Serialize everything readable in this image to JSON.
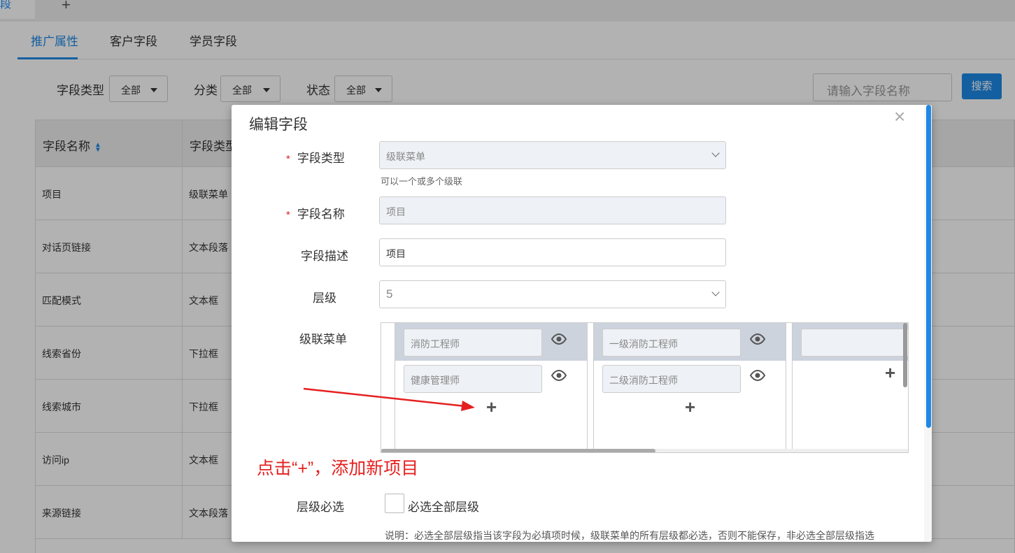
{
  "top_tabs": {
    "active_label": "段",
    "add_label": "+"
  },
  "subtabs": [
    "推广属性",
    "客户字段",
    "学员字段"
  ],
  "filters": {
    "field_type_label": "字段类型",
    "field_type_value": "全部",
    "category_label": "分类",
    "category_value": "全部",
    "status_label": "状态",
    "status_value": "全部"
  },
  "search": {
    "placeholder": "请输入字段名称",
    "button_label": "搜索"
  },
  "table": {
    "headers": [
      "字段名称",
      "字段类型"
    ],
    "rows": [
      [
        "项目",
        "级联菜单"
      ],
      [
        "对话页链接",
        "文本段落"
      ],
      [
        "匹配模式",
        "文本框"
      ],
      [
        "线索省份",
        "下拉框"
      ],
      [
        "线索城市",
        "下拉框"
      ],
      [
        "访问ip",
        "文本框"
      ],
      [
        "来源链接",
        "文本段落"
      ]
    ]
  },
  "modal": {
    "title": "编辑字段",
    "close_label": "×",
    "field_type_label": "字段类型",
    "field_type_value": "级联菜单",
    "field_type_help": "可以一个或多个级联",
    "field_name_label": "字段名称",
    "field_name_value": "项目",
    "field_desc_label": "字段描述",
    "field_desc_value": "项目",
    "level_label": "层级",
    "level_value": "5",
    "cascade_label": "级联菜单",
    "cascade_columns": [
      {
        "items": [
          "消防工程师",
          "健康管理师"
        ]
      },
      {
        "items": [
          "一级消防工程师",
          "二级消防工程师"
        ]
      },
      {
        "items": [
          ""
        ]
      }
    ],
    "add_label": "+",
    "annotation": "点击“+”，添加新项目",
    "required_levels_label": "层级必选",
    "required_levels_checkbox_label": "必选全部层级",
    "note": "说明：必选全部层级指当该字段为必填项时候，级联菜单的所有层级都必选，否则不能保存，非必选全部层级指选"
  }
}
